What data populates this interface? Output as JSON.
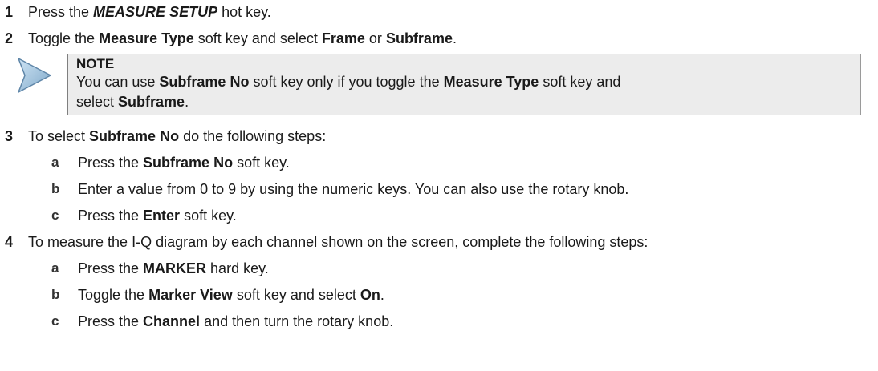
{
  "steps": [
    {
      "num": "1",
      "parts": [
        "Press the ",
        "MEASURE SETUP",
        " hot key."
      ]
    },
    {
      "num": "2",
      "parts": [
        "Toggle the ",
        "Measure Type",
        " soft key and select ",
        "Frame",
        " or ",
        "Subframe",
        "."
      ]
    },
    {
      "num": "3",
      "parts": [
        "To select ",
        "Subframe No",
        " do the following steps:"
      ]
    },
    {
      "num": "4",
      "parts": [
        "To measure the I-Q diagram by each channel shown on the screen, complete the following steps:"
      ]
    }
  ],
  "note": {
    "title": "NOTE",
    "line1": [
      "You can use ",
      "Subframe No",
      " soft key only if you toggle the ",
      "Measure Type",
      " soft key and"
    ],
    "line2": [
      "select ",
      "Subframe",
      "."
    ],
    "icon": "note-arrow-icon"
  },
  "substeps_3": [
    {
      "letter": "a",
      "parts": [
        "Press the ",
        "Subframe No",
        " soft key."
      ]
    },
    {
      "letter": "b",
      "parts": [
        "Enter a value from 0 to 9 by using the numeric keys. You can also use the rotary knob."
      ]
    },
    {
      "letter": "c",
      "parts": [
        "Press the ",
        "Enter",
        " soft key."
      ]
    }
  ],
  "substeps_4": [
    {
      "letter": "a",
      "parts": [
        "Press the ",
        "MARKER",
        " hard key."
      ]
    },
    {
      "letter": "b",
      "parts": [
        "Toggle the ",
        "Marker View",
        " soft key and select ",
        "On",
        "."
      ]
    },
    {
      "letter": "c",
      "parts": [
        "Press the ",
        "Channel",
        " and then turn the rotary knob."
      ]
    }
  ]
}
